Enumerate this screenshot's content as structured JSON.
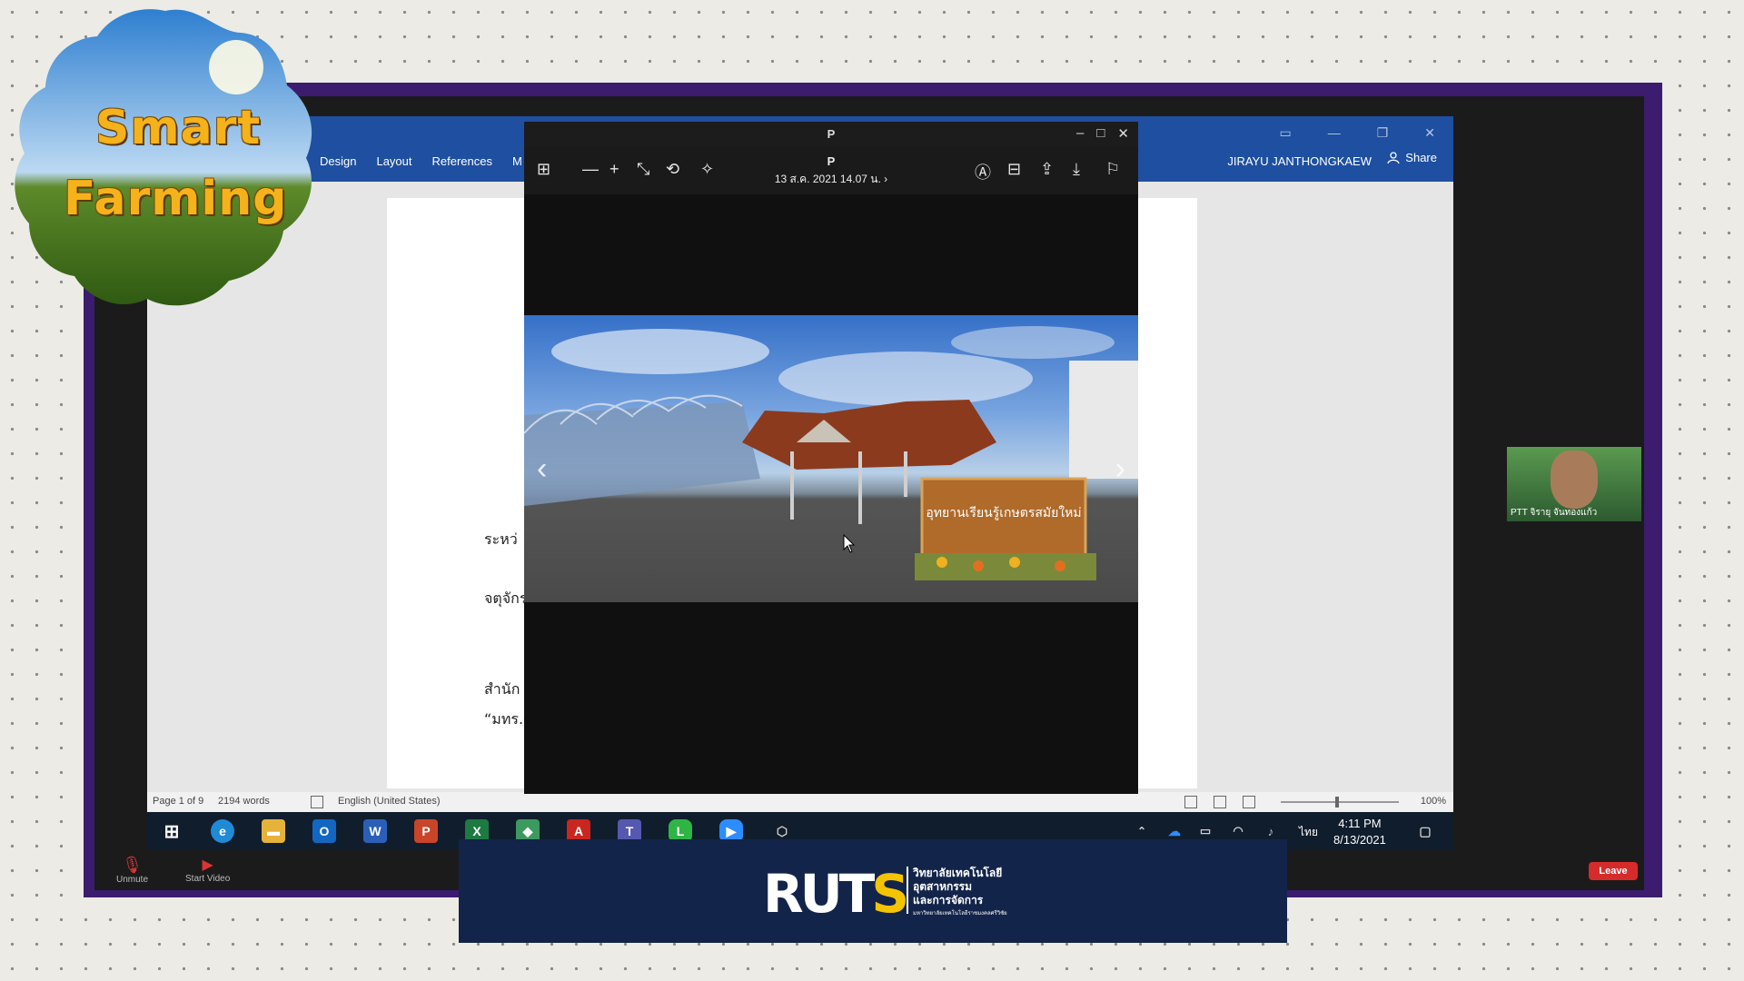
{
  "badge": {
    "line1": "Smart",
    "line2": "Farming"
  },
  "word": {
    "ribbon_tabs": [
      "Design",
      "Layout",
      "References",
      "M"
    ],
    "user": "JIRAYU JANTHONGKAEW",
    "share": "Share",
    "doc_lines": [
      "ระหว่",
      "จตุจักร",
      "สำนัก",
      "“มทร.ศ"
    ],
    "status": {
      "page": "Page 1 of 9",
      "words": "2194 words",
      "language": "English (United States)",
      "zoom": "100%"
    }
  },
  "viewer": {
    "window_title": "P",
    "file_name": "P",
    "date": "13 ส.ค. 2021 14.07 น.",
    "photo_sign_text": "อุทยานเรียนรู้เกษตรสมัยใหม่"
  },
  "taskbar": {
    "apps": [
      "windows",
      "edge",
      "file-explorer",
      "outlook",
      "word",
      "powerpoint",
      "excel",
      "photos",
      "acrobat",
      "teams",
      "line",
      "zoom",
      "package"
    ],
    "language": "ไทย",
    "time": "4:11 PM",
    "date": "8/13/2021"
  },
  "zoom": {
    "mute_label": "Unmute",
    "video_label": "Start Video",
    "leave_label": "Leave",
    "participant_name": "PTT จิรายุ จันทองแก้ว"
  },
  "banner": {
    "logo_text_1": "RUT",
    "logo_text_2": "S",
    "line1": "วิทยาลัยเทคโนโลยี",
    "line2": "อุตสาหกรรม",
    "line3": "และการจัดการ",
    "small": "มหาวิทยาลัยเทคโนโลยีราชมงคลศรีวิชัย"
  }
}
